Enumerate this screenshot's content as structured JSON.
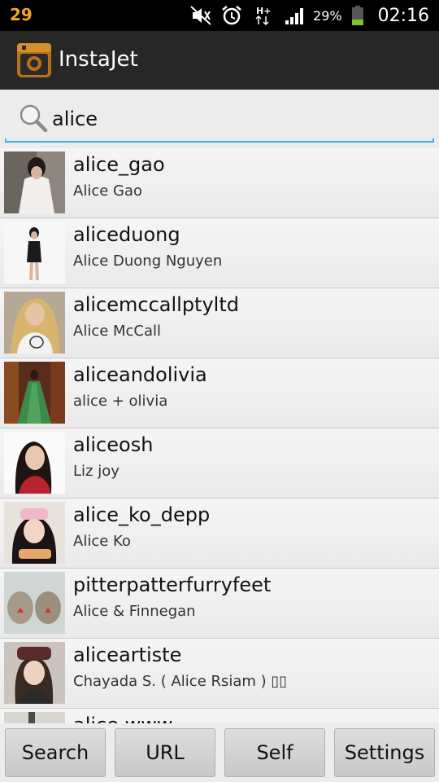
{
  "status_bar": {
    "notification": "29",
    "battery": "29%",
    "time": "02:16",
    "icons": [
      "mute-icon",
      "alarm-icon",
      "data-transfer-icon",
      "signal-icon",
      "battery-icon"
    ]
  },
  "app_bar": {
    "title": "InstaJet",
    "logo_icon": "camera-icon"
  },
  "search": {
    "value": "alice",
    "icon": "search-icon",
    "accent": "#33b5e5"
  },
  "results": [
    {
      "username": "alice_gao",
      "fullname": "Alice Gao"
    },
    {
      "username": "aliceduong",
      "fullname": "Alice Duong Nguyen"
    },
    {
      "username": "alicemccallptyltd",
      "fullname": "Alice McCall"
    },
    {
      "username": "aliceandolivia",
      "fullname": "alice + olivia"
    },
    {
      "username": "aliceosh",
      "fullname": "Liz joy"
    },
    {
      "username": "alice_ko_depp",
      "fullname": "Alice Ko"
    },
    {
      "username": "pitterpatterfurryfeet",
      "fullname": "Alice & Finnegan"
    },
    {
      "username": "aliceartiste",
      "fullname": "Chayada S.  ( Alice Rsiam ) ▯▯"
    },
    {
      "username": "alice.www",
      "fullname": ""
    }
  ],
  "buttons": {
    "search": "Search",
    "url": "URL",
    "self": "Self",
    "settings": "Settings"
  }
}
